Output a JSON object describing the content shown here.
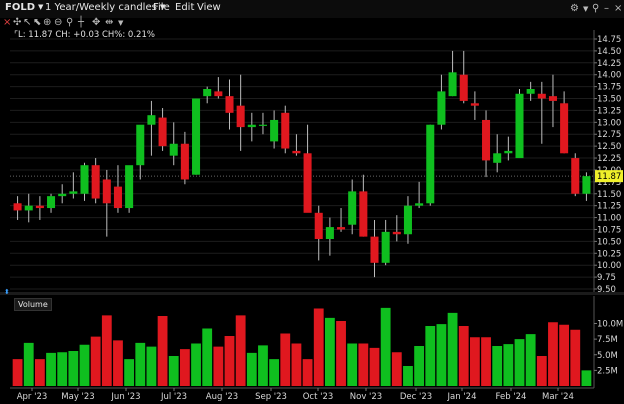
{
  "titlebar": {
    "symbol": "FOLD",
    "period": "1 Year/Weekly candles",
    "menus": [
      "File",
      "Edit",
      "View"
    ]
  },
  "quote_text": "L: 11.87 CH: +0.03 CH%: 0.21%",
  "volume_label": "Volume",
  "price_tag": "11.87",
  "colors": {
    "up": "#0fbf1f",
    "down": "#e0181f",
    "background": "#000000",
    "price_tag": "#f0f02a"
  },
  "icons": [
    "gear-icon",
    "pin-icon",
    "minimize-icon",
    "close-icon"
  ],
  "chart_data": [
    {
      "type": "candlestick",
      "interval": "weekly",
      "x_labels": [
        "Apr '23",
        "May '23",
        "Jun '23",
        "Jul '23",
        "Aug '23",
        "Sep '23",
        "Oct '23",
        "Nov '23",
        "Dec '23",
        "Jan '24",
        "Feb '24",
        "Mar '24"
      ],
      "ylim": [
        9.5,
        14.75
      ],
      "y_ticks": [
        "14.75",
        "14.50",
        "14.25",
        "14.00",
        "13.75",
        "13.50",
        "13.25",
        "13.00",
        "12.75",
        "12.50",
        "12.25",
        "12.00",
        "11.75",
        "11.50",
        "11.25",
        "11.00",
        "10.75",
        "10.50",
        "10.25",
        "10.00",
        "9.75",
        "9.50"
      ],
      "last_price": 11.87,
      "candles": [
        {
          "o": 11.3,
          "h": 11.45,
          "l": 10.95,
          "c": 11.15
        },
        {
          "o": 11.15,
          "h": 11.5,
          "l": 10.9,
          "c": 11.25
        },
        {
          "o": 11.25,
          "h": 11.45,
          "l": 10.95,
          "c": 11.2
        },
        {
          "o": 11.2,
          "h": 11.5,
          "l": 11.1,
          "c": 11.45
        },
        {
          "o": 11.45,
          "h": 11.7,
          "l": 11.3,
          "c": 11.5
        },
        {
          "o": 11.5,
          "h": 11.95,
          "l": 11.4,
          "c": 11.55
        },
        {
          "o": 11.5,
          "h": 12.15,
          "l": 11.35,
          "c": 12.1
        },
        {
          "o": 12.1,
          "h": 12.25,
          "l": 11.3,
          "c": 11.4
        },
        {
          "o": 11.8,
          "h": 12.0,
          "l": 10.6,
          "c": 11.3
        },
        {
          "o": 11.65,
          "h": 12.1,
          "l": 11.1,
          "c": 11.2
        },
        {
          "o": 11.2,
          "h": 12.05,
          "l": 11.1,
          "c": 12.1
        },
        {
          "o": 12.1,
          "h": 12.65,
          "l": 11.8,
          "c": 12.95
        },
        {
          "o": 12.95,
          "h": 13.45,
          "l": 12.3,
          "c": 13.15
        },
        {
          "o": 13.1,
          "h": 13.3,
          "l": 12.4,
          "c": 12.5
        },
        {
          "o": 12.3,
          "h": 13.0,
          "l": 12.1,
          "c": 12.55
        },
        {
          "o": 12.55,
          "h": 12.8,
          "l": 11.7,
          "c": 11.8
        },
        {
          "o": 11.9,
          "h": 13.5,
          "l": 11.9,
          "c": 13.5
        },
        {
          "o": 13.55,
          "h": 13.75,
          "l": 13.4,
          "c": 13.7
        },
        {
          "o": 13.65,
          "h": 13.95,
          "l": 13.5,
          "c": 13.55
        },
        {
          "o": 13.55,
          "h": 13.9,
          "l": 12.85,
          "c": 13.2
        },
        {
          "o": 13.35,
          "h": 14.0,
          "l": 12.4,
          "c": 12.9
        },
        {
          "o": 12.9,
          "h": 13.2,
          "l": 12.6,
          "c": 12.95
        },
        {
          "o": 12.95,
          "h": 13.2,
          "l": 12.75,
          "c": 12.95
        },
        {
          "o": 12.6,
          "h": 13.25,
          "l": 12.45,
          "c": 13.05
        },
        {
          "o": 13.2,
          "h": 13.35,
          "l": 12.35,
          "c": 12.45
        },
        {
          "o": 12.4,
          "h": 12.75,
          "l": 12.3,
          "c": 12.35
        },
        {
          "o": 12.35,
          "h": 12.95,
          "l": 11.55,
          "c": 11.1
        },
        {
          "o": 11.1,
          "h": 11.25,
          "l": 10.1,
          "c": 10.55
        },
        {
          "o": 10.55,
          "h": 11.0,
          "l": 10.2,
          "c": 10.8
        },
        {
          "o": 10.8,
          "h": 11.2,
          "l": 10.7,
          "c": 10.75
        },
        {
          "o": 10.85,
          "h": 11.8,
          "l": 10.65,
          "c": 11.55
        },
        {
          "o": 11.55,
          "h": 11.9,
          "l": 10.6,
          "c": 10.6
        },
        {
          "o": 10.6,
          "h": 10.95,
          "l": 9.75,
          "c": 10.05
        },
        {
          "o": 10.05,
          "h": 10.95,
          "l": 10.0,
          "c": 10.7
        },
        {
          "o": 10.7,
          "h": 11.05,
          "l": 10.5,
          "c": 10.65
        },
        {
          "o": 10.65,
          "h": 11.45,
          "l": 10.45,
          "c": 11.25
        },
        {
          "o": 11.25,
          "h": 11.75,
          "l": 11.2,
          "c": 11.3
        },
        {
          "o": 11.3,
          "h": 12.95,
          "l": 11.25,
          "c": 12.95
        },
        {
          "o": 12.95,
          "h": 14.0,
          "l": 12.85,
          "c": 13.65
        },
        {
          "o": 13.55,
          "h": 14.5,
          "l": 13.55,
          "c": 14.05
        },
        {
          "o": 14.0,
          "h": 14.5,
          "l": 13.4,
          "c": 13.45
        },
        {
          "o": 13.4,
          "h": 13.65,
          "l": 13.05,
          "c": 13.35
        },
        {
          "o": 13.05,
          "h": 13.25,
          "l": 11.85,
          "c": 12.2
        },
        {
          "o": 12.15,
          "h": 12.75,
          "l": 11.95,
          "c": 12.35
        },
        {
          "o": 12.35,
          "h": 12.7,
          "l": 12.2,
          "c": 12.4
        },
        {
          "o": 12.25,
          "h": 13.7,
          "l": 12.25,
          "c": 13.6
        },
        {
          "o": 13.6,
          "h": 13.85,
          "l": 13.45,
          "c": 13.7
        },
        {
          "o": 13.6,
          "h": 13.85,
          "l": 12.55,
          "c": 13.5
        },
        {
          "o": 13.55,
          "h": 14.0,
          "l": 12.9,
          "c": 13.45
        },
        {
          "o": 13.4,
          "h": 13.65,
          "l": 12.35,
          "c": 12.35
        },
        {
          "o": 12.25,
          "h": 12.35,
          "l": 11.45,
          "c": 11.5
        },
        {
          "o": 11.5,
          "h": 11.95,
          "l": 11.35,
          "c": 11.87
        }
      ]
    },
    {
      "type": "bar",
      "name": "Volume",
      "ylim": [
        0,
        12000000
      ],
      "y_ticks": [
        "10.0M",
        "7.5M",
        "5.0M",
        "2.5M"
      ],
      "values": [
        4300000,
        6900000,
        4300000,
        5300000,
        5400000,
        5600000,
        6600000,
        7900000,
        11300000,
        7300000,
        4300000,
        6900000,
        6300000,
        11200000,
        4800000,
        5900000,
        6800000,
        9200000,
        6300000,
        8000000,
        11300000,
        5300000,
        6500000,
        4300000,
        8400000,
        6800000,
        4300000,
        12400000,
        10900000,
        10400000,
        6800000,
        6800000,
        6100000,
        12500000,
        5400000,
        3200000,
        6400000,
        9600000,
        9900000,
        11700000,
        9600000,
        7800000,
        7800000,
        6400000,
        6700000,
        7500000,
        8300000,
        4800000,
        10200000,
        9800000,
        9000000,
        2500000
      ]
    }
  ]
}
